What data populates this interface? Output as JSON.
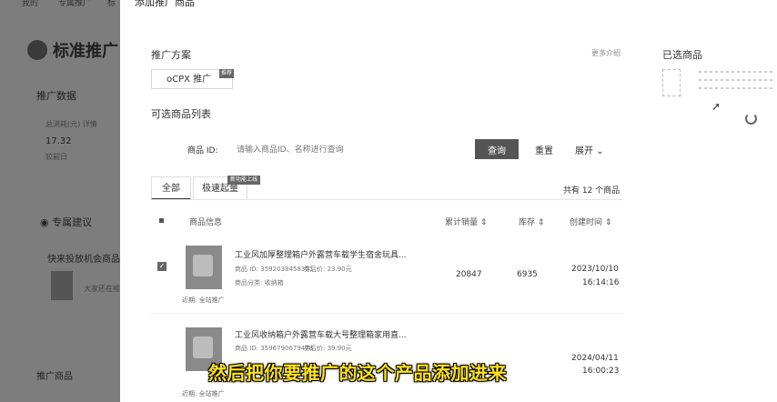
{
  "background": {
    "top_tabs": [
      "我的",
      "专属推广",
      "标"
    ],
    "brand": "标准推广",
    "promo_data_label": "推广数据",
    "stat_label": "总消耗(元) 详情",
    "stat_value": "17.32",
    "stat_sub": "较前日",
    "exclusive_label": "专属建议",
    "opportunity_label": "快来投放机会商品",
    "thumb_note": "大家还在推",
    "promo_goods_label": "推广商品"
  },
  "panel": {
    "title": "添加推广商品",
    "plan_label": "推广方案",
    "more_intro": "更多介绍",
    "plan_option": "oCPX 推广",
    "plan_tag": "推荐",
    "selected_label": "已选商品",
    "selectable_list_label": "可选商品列表",
    "product_id_label": "商品 ID:",
    "search_placeholder": "请输入商品ID、名称进行查询",
    "query_button": "查询",
    "reset_button": "重置",
    "expand_button": "展开",
    "tab_all": "全部",
    "tab_fast": "极速起量",
    "fast_badge": "新功能上线",
    "total_count": "共有 12 个商品",
    "columns": {
      "info": "商品信息",
      "sales": "累计销量",
      "stock": "库存",
      "created": "创建时间"
    },
    "rows": [
      {
        "name": "工业风加厚整理箱户外露营车载学生宿舍玩具...",
        "id_line": "商品 ID: 3592038458351",
        "price": "券后价: 23.90元",
        "category": "商品分类: 收纳箱",
        "sales": "20847",
        "stock": "6935",
        "date": "2023/10/10",
        "time": "16:14:16",
        "note": "近期: 全站推广"
      },
      {
        "name": "工业风收纳箱户外露营车载大号整理箱家用直...",
        "id_line": "商品 ID: 3596790679478",
        "price": "券后价: 39.90元",
        "category": "",
        "sales": "",
        "stock": "",
        "date": "2024/04/11",
        "time": "16:00:23",
        "note": "近期: 全站推广"
      }
    ]
  },
  "caption": "然后把你要推广的这个产品添加进来"
}
